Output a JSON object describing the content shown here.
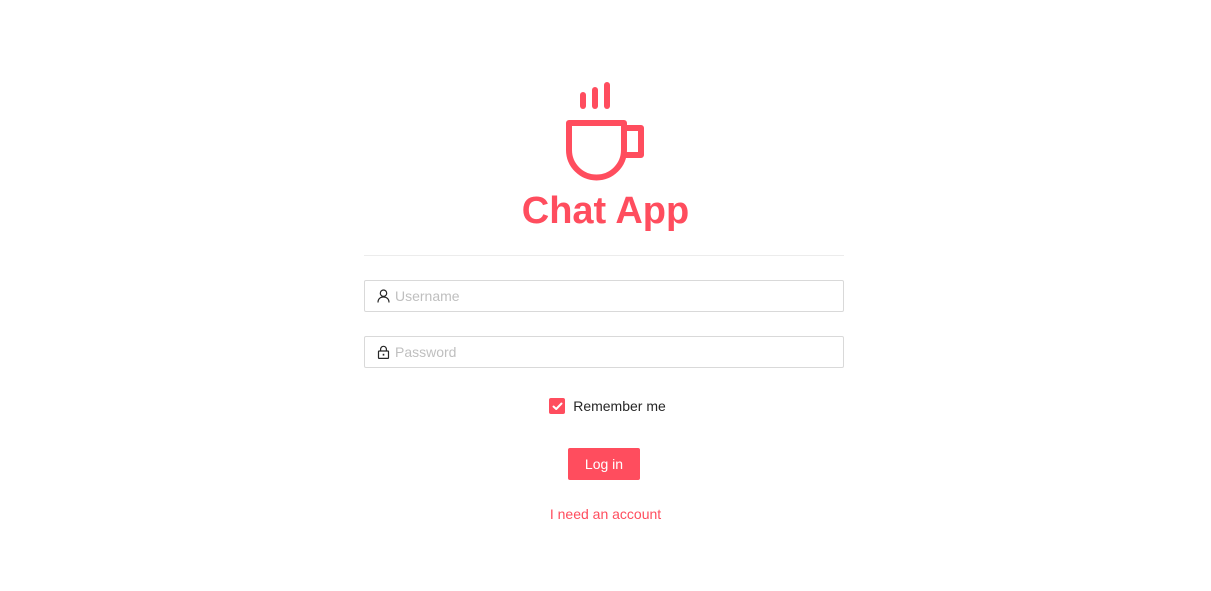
{
  "app": {
    "title": "Chat App",
    "logo_icon": "coffee-cup-icon"
  },
  "form": {
    "username": {
      "placeholder": "Username",
      "value": "",
      "icon": "user-icon"
    },
    "password": {
      "placeholder": "Password",
      "value": "",
      "icon": "lock-icon"
    },
    "remember": {
      "label": "Remember me",
      "checked": true
    },
    "login_label": "Log in",
    "register_link": "I need an account"
  },
  "colors": {
    "accent": "#ff4d5e",
    "border": "#d9d9d9",
    "placeholder": "#bfbfbf",
    "text": "#262626"
  }
}
